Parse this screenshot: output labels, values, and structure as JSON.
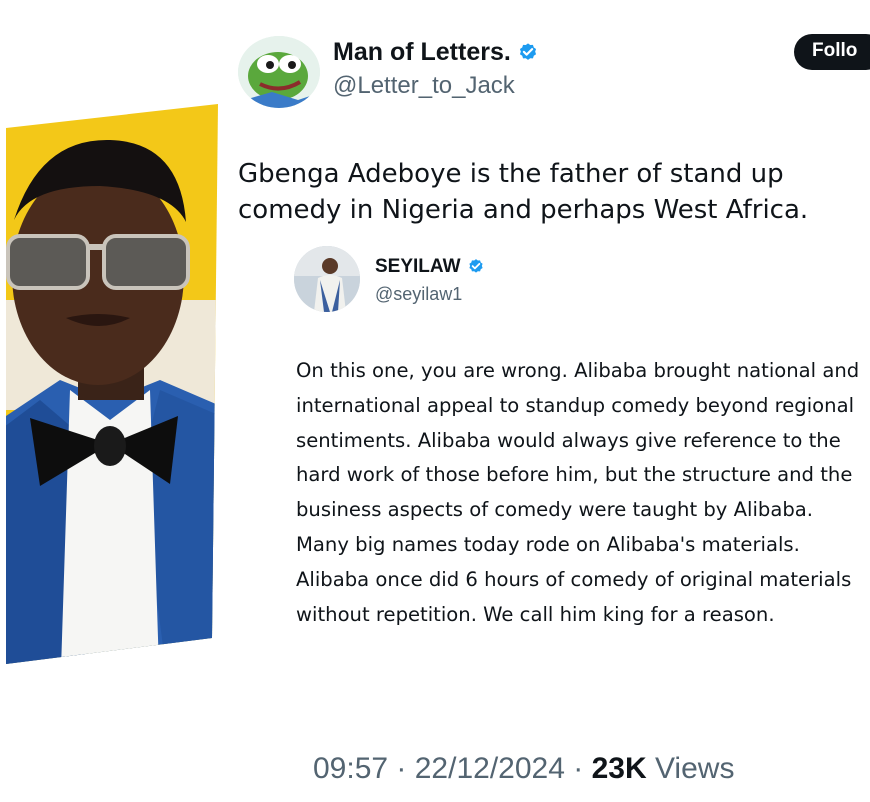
{
  "main_tweet": {
    "display_name": "Man of Letters.",
    "handle": "@Letter_to_Jack",
    "follow_label": "Follo",
    "text": "Gbenga Adeboye is the father of stand up comedy in Nigeria and perhaps West Africa.",
    "avatar_icon": "pepe-frog-avatar"
  },
  "quoted_reply": {
    "display_name": "SEYILAW",
    "handle": "@seyilaw1",
    "text": "On this one, you are wrong. Alibaba brought national and international appeal to standup comedy beyond regional sentiments. Alibaba would always give reference to the hard work of those before him, but the structure and the business aspects of comedy were taught by Alibaba. Many big names today rode on Alibaba's materials. Alibaba once did 6 hours of comedy of original materials without repetition. We call him king for a reason.",
    "avatar_icon": "person-avatar"
  },
  "footer": {
    "time": "09:57",
    "date": "22/12/2024",
    "views_count": "23K",
    "views_label": "Views"
  },
  "colors": {
    "verified_blue": "#1d9bf0",
    "secondary_text": "#536471",
    "primary_text": "#0f1419",
    "photo_yellow": "#f3c818",
    "suit_blue": "#2a5fb0"
  }
}
